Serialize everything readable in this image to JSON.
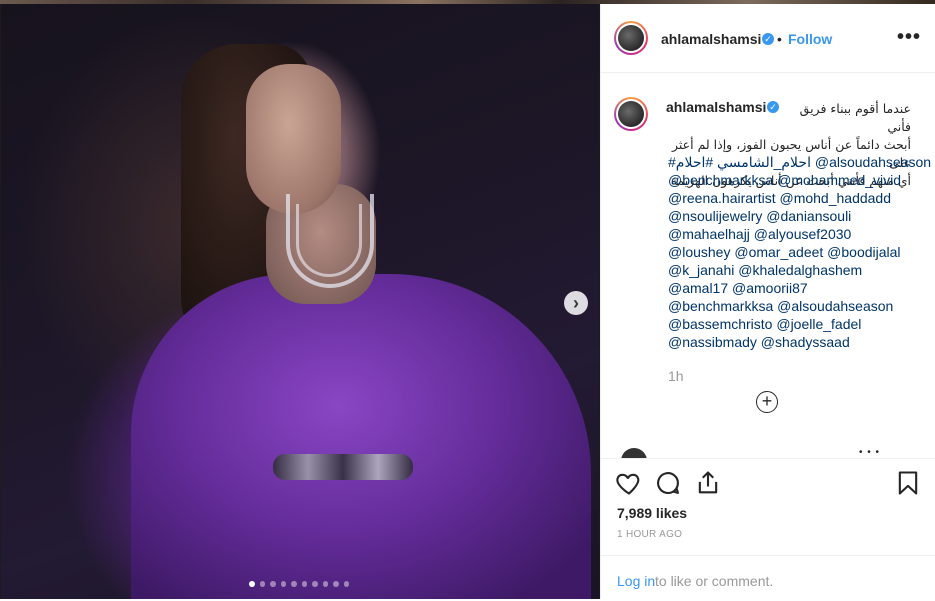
{
  "post": {
    "username": "ahlamalshamsi",
    "follow_label": "Follow",
    "separator": "•",
    "more_label": "•••",
    "caption_arabic": [
      "عندما أقوم ببناء فريق فأني",
      "أبحث دائماً عن أناس يحبون الفوز، وإذا لم أعثر على",
      "أي منهم فأنني أبحث عن أناس يكرهون الهزيمة"
    ],
    "mention_lines": [
      "#احلام_الشامسي #احلام @alsoudahseason",
      "@benchmarkksa @mohammed_vivid",
      "@reena.hairartist @mohd_haddadd",
      "@nsoulijewelry @daniansouli",
      "@mahaelhajj @alyousef2030",
      "@loushey @omar_adeet @boodijalal",
      "@k_janahi @khaledalghashem",
      "@amal17 @amoorii87",
      "@benchmarkksa @alsoudahseason",
      "@bassemchristo @joelle_fadel",
      "@nassibmady @shadyssaad"
    ],
    "time_short": "1h",
    "load_more": "+",
    "likes": "7,989 likes",
    "time_ago": "1 HOUR AGO",
    "login_link": "Log in",
    "login_rest": " to like or comment."
  },
  "carousel": {
    "next_label": "›",
    "dot_count": 10,
    "active_dot": 0
  },
  "colors": {
    "link": "#003569",
    "accent": "#3897f0",
    "muted": "#999999",
    "dress_purple": "#642c9a"
  },
  "icons": {
    "like": "heart-icon",
    "comment": "comment-icon",
    "share": "share-icon",
    "save": "bookmark-icon",
    "verified": "verified-badge-icon",
    "next": "chevron-right-icon",
    "add": "plus-circle-icon"
  }
}
